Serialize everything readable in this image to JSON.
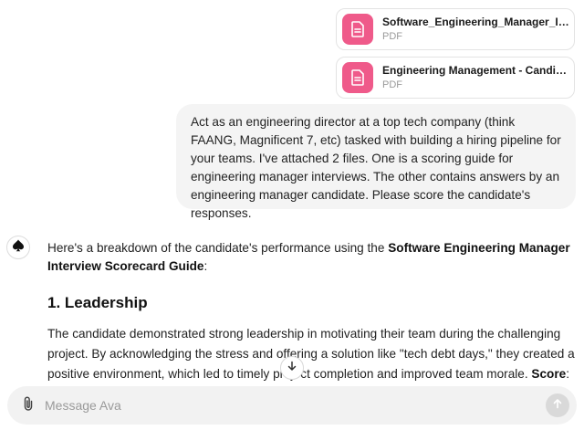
{
  "attachments": [
    {
      "name": "Software_Engineering_Manager_Int...",
      "type": "PDF",
      "icon": "document-icon"
    },
    {
      "name": "Engineering Management - Candida...",
      "type": "PDF",
      "icon": "document-icon"
    }
  ],
  "user_message": "Act as an engineering director at a top tech company (think FAANG, Magnificent 7, etc) tasked with building a hiring pipeline for your teams. I've attached 2 files. One is a scoring guide for engineering manager interviews. The other contains answers by an engineering manager candidate. Please score the candidate's responses.",
  "assistant": {
    "avatar_icon": "spade-icon",
    "intro_prefix": "Here's a breakdown of the candidate's performance using the ",
    "intro_bold": "Software Engineering Manager Interview Scorecard Guide",
    "intro_suffix": ":",
    "section_heading": "1. Leadership",
    "section_body": "The candidate demonstrated strong leadership in motivating their team during the challenging project. By acknowledging the stress and offering a solution like \"tech debt days,\" they created a positive environment, which led to timely project completion and improved team morale. ",
    "section_body_bold": "Score",
    "section_body_tail": ":"
  },
  "composer": {
    "placeholder": "Message Ava",
    "attach_icon": "paperclip-icon",
    "send_icon": "arrow-up-icon"
  },
  "scroll_icon": "arrow-down-icon",
  "colors": {
    "file_icon_bg": "#ef5a8a",
    "bubble_bg": "#f4f4f4",
    "composer_bg": "#f2f2f2"
  }
}
